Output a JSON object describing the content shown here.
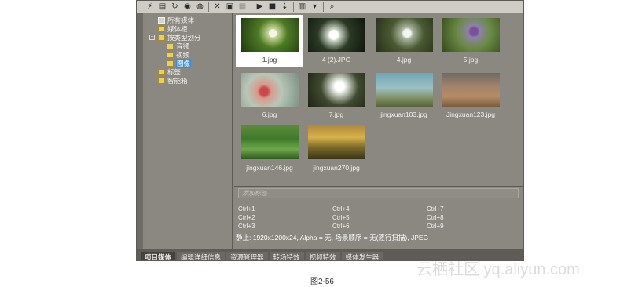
{
  "toolbar": {
    "icons": [
      "lightning-icon",
      "import-icon",
      "sync-icon",
      "globe-icon",
      "web-icon",
      "delete-icon",
      "properties-icon",
      "play-icon",
      "stop-icon",
      "auto-preview-icon",
      "view-icon",
      "view-dropdown-icon",
      "zoom-icon"
    ]
  },
  "tree": {
    "items": [
      {
        "label": "所有媒体"
      },
      {
        "label": "媒体柜"
      },
      {
        "label": "按类型划分",
        "expander": "−"
      },
      {
        "label": "音频"
      },
      {
        "label": "视频"
      },
      {
        "label": "图像"
      },
      {
        "label": "标签"
      },
      {
        "label": "智能箱"
      }
    ]
  },
  "thumbnails": [
    {
      "name": "1.jpg",
      "selected": true
    },
    {
      "name": "4 (2).JPG"
    },
    {
      "name": "4.jpg"
    },
    {
      "name": "5.jpg"
    },
    {
      "name": "6.jpg"
    },
    {
      "name": "7.jpg"
    },
    {
      "name": "jingxuan103.jpg"
    },
    {
      "name": "Jingxuan123.jpg"
    },
    {
      "name": "jingxuan146.jpg"
    },
    {
      "name": "jingxuan270.jpg"
    }
  ],
  "tags": {
    "placeholder": "添加标签",
    "shortcuts": [
      "Ctrl+1",
      "Ctrl+4",
      "Ctrl+7",
      "Ctrl+2",
      "Ctrl+5",
      "Ctrl+8",
      "Ctrl+3",
      "Ctrl+6",
      "Ctrl+9"
    ]
  },
  "status": "静止: 1920x1200x24, Alpha = 无, 场景顺序 = 无(逐行扫描), JPEG",
  "tabs": [
    "项目媒体",
    "编辑详细信息",
    "资源管理器",
    "转场特效",
    "视频特效",
    "媒体发生器"
  ],
  "caption": "图2-56",
  "watermark": "云栖社区 yq.aliyun.com",
  "colors": {
    "accent": "#3b8fd6",
    "panel": "#8b8882",
    "folder": "#e9cf62"
  }
}
